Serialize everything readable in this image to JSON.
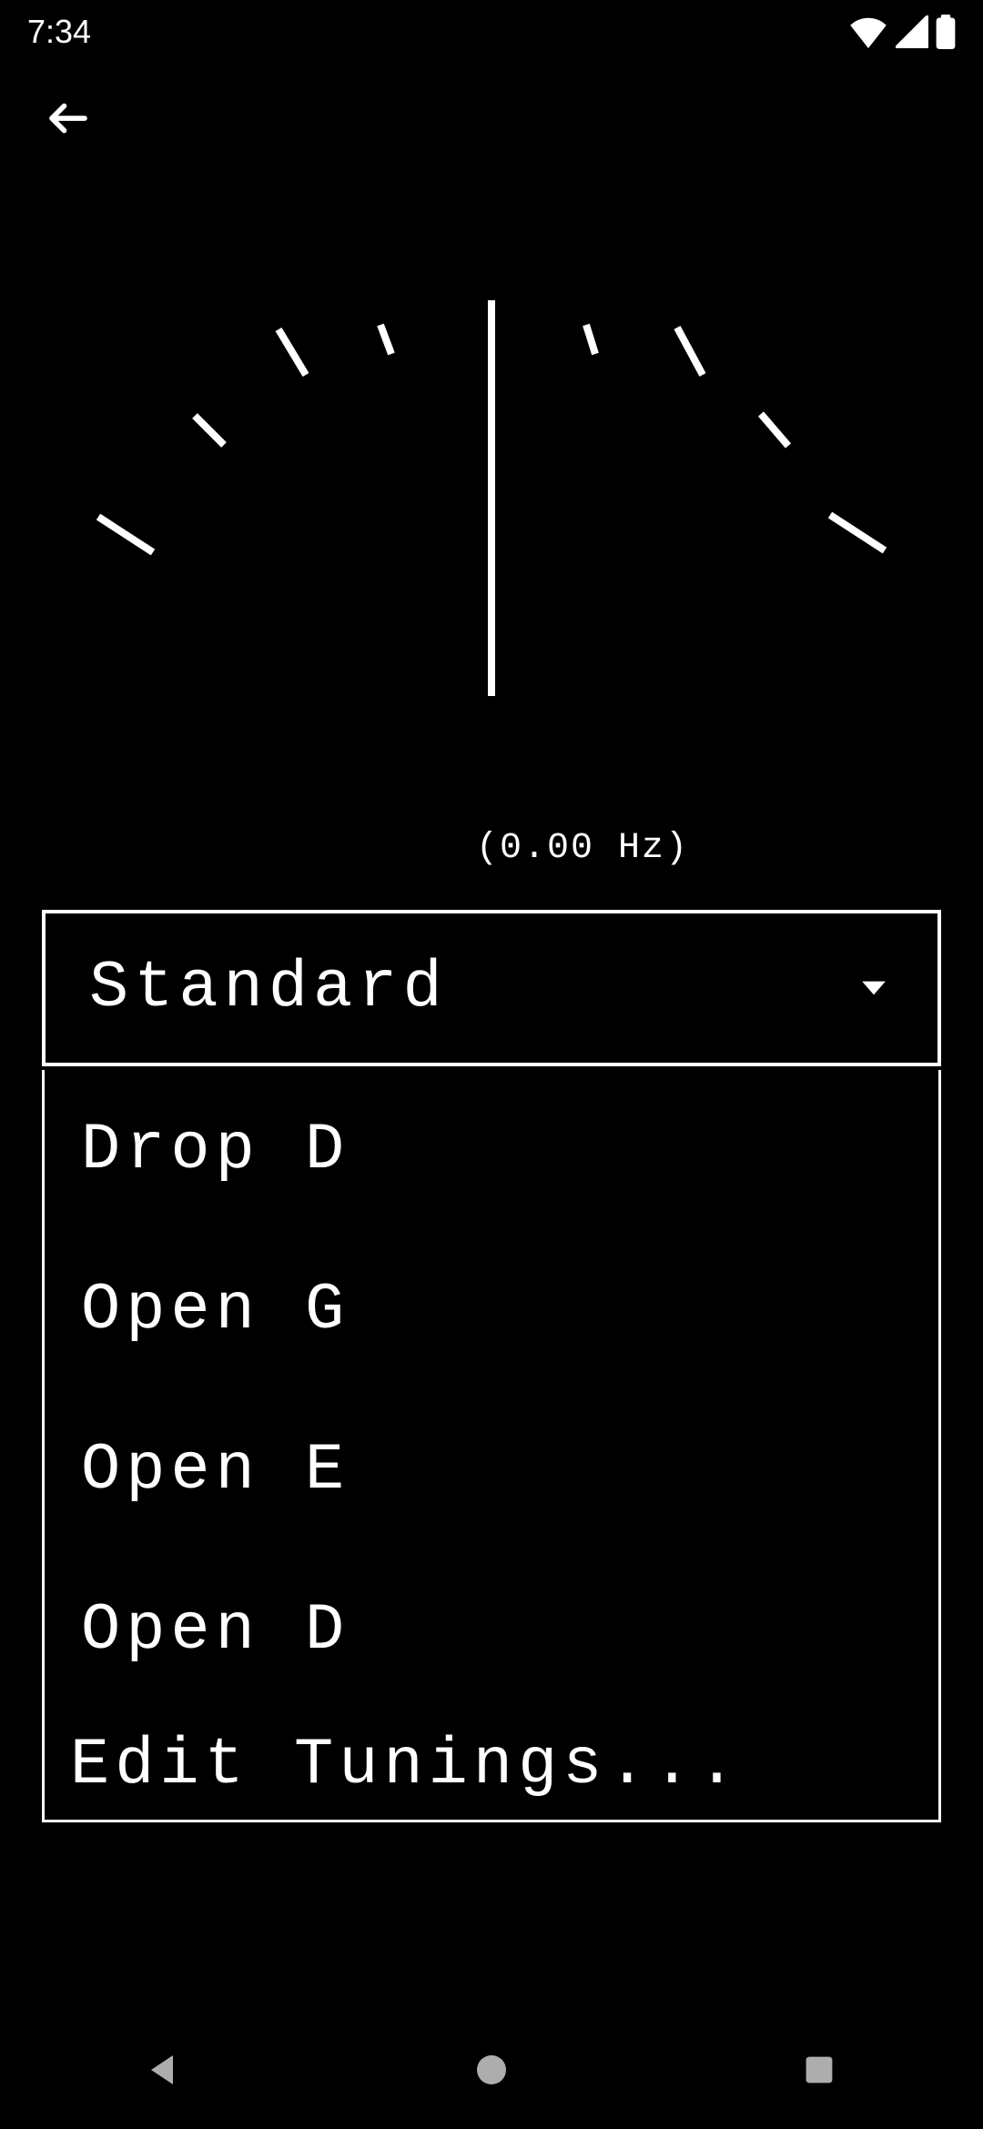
{
  "status": {
    "time": "7:34"
  },
  "tuner": {
    "frequency_display": "(0.00 Hz)",
    "selected_tuning": "Standard",
    "options": [
      "Drop D",
      "Open G",
      "Open E",
      "Open D",
      "Edit Tunings..."
    ]
  }
}
